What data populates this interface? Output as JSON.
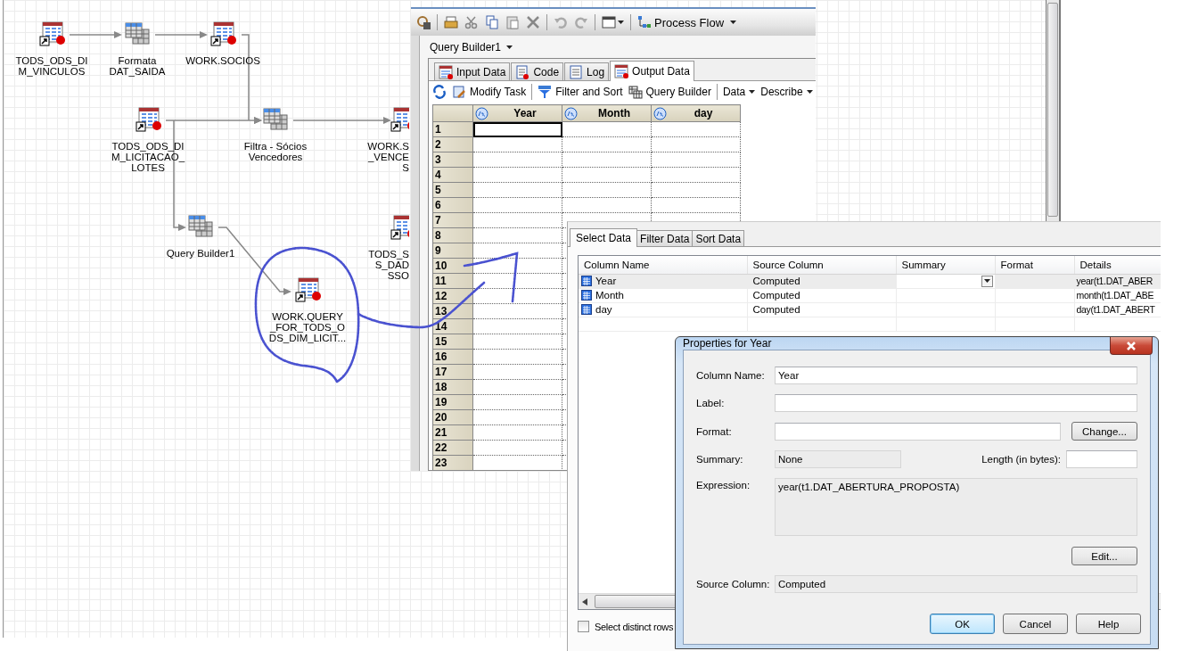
{
  "flow": {
    "nodes": [
      {
        "kind": "dataset",
        "lines": [
          "TODS_ODS_DI",
          "M_VINCULOS"
        ]
      },
      {
        "kind": "task",
        "lines": [
          "Formata",
          "DAT_SAIDA"
        ]
      },
      {
        "kind": "dataset",
        "lines": [
          "WORK.SOCIOS"
        ]
      },
      {
        "kind": "dataset",
        "lines": [
          "TODS_ODS_DI",
          "M_LICITACAO_",
          "LOTES"
        ]
      },
      {
        "kind": "task",
        "lines": [
          "Filtra - Sócios",
          "Vencedores"
        ]
      },
      {
        "kind": "dataset",
        "lines": [
          "WORK.S",
          "_VENCE",
          "S"
        ]
      },
      {
        "kind": "task",
        "lines": [
          "Query Builder1"
        ]
      },
      {
        "kind": "dataset",
        "lines": [
          "TODS_S",
          "S_DAD",
          "SSO"
        ]
      },
      {
        "kind": "dataset",
        "lines": [
          "WORK.QUERY",
          "_FOR_TODS_O",
          "DS_DIM_LICIT..."
        ]
      }
    ]
  },
  "results_window": {
    "toolbar": {
      "process_flow": "Process Flow"
    },
    "title": "Query Builder1",
    "tabs": [
      {
        "label": "Input Data",
        "selected": false
      },
      {
        "label": "Code",
        "selected": false
      },
      {
        "label": "Log",
        "selected": false
      },
      {
        "label": "Output Data",
        "selected": true
      }
    ],
    "actions": [
      {
        "kind": "button",
        "label": "Modify Task"
      },
      {
        "kind": "button",
        "label": "Filter and Sort"
      },
      {
        "kind": "button",
        "label": "Query Builder"
      },
      {
        "kind": "menu",
        "label": "Data"
      },
      {
        "kind": "menu",
        "label": "Describe"
      }
    ],
    "grid": {
      "columns": [
        "Year",
        "Month",
        "day"
      ],
      "rows": [
        {
          "label": "1",
          "selected": true
        },
        {
          "label": "2",
          "selected": false
        },
        {
          "label": "3",
          "selected": false
        },
        {
          "label": "4",
          "selected": false
        },
        {
          "label": "5",
          "selected": false
        },
        {
          "label": "6",
          "selected": false
        },
        {
          "label": "7",
          "selected": false
        },
        {
          "label": "8",
          "selected": false
        },
        {
          "label": "9",
          "selected": false
        },
        {
          "label": "10",
          "selected": false
        },
        {
          "label": "11",
          "selected": false
        },
        {
          "label": "12",
          "selected": false
        },
        {
          "label": "13",
          "selected": false
        },
        {
          "label": "14",
          "selected": false
        },
        {
          "label": "15",
          "selected": false
        },
        {
          "label": "16",
          "selected": false
        },
        {
          "label": "17",
          "selected": false
        },
        {
          "label": "18",
          "selected": false
        },
        {
          "label": "19",
          "selected": false
        },
        {
          "label": "20",
          "selected": false
        },
        {
          "label": "21",
          "selected": false
        },
        {
          "label": "22",
          "selected": false
        },
        {
          "label": "23",
          "selected": false
        }
      ]
    }
  },
  "query_panel": {
    "tabs": [
      {
        "label": "Select Data",
        "selected": true
      },
      {
        "label": "Filter Data",
        "selected": false
      },
      {
        "label": "Sort Data",
        "selected": false
      }
    ],
    "table": {
      "columns": [
        "Column Name",
        "Source Column",
        "Summary",
        "Format",
        "Details"
      ],
      "rows": [
        {
          "column_name": "Year",
          "source_column": "Computed",
          "details": "year(t1.DAT_ABER",
          "selected": true
        },
        {
          "column_name": "Month",
          "source_column": "Computed",
          "details": "month(t1.DAT_ABE",
          "selected": false
        },
        {
          "column_name": "day",
          "source_column": "Computed",
          "details": "day(t1.DAT_ABERT",
          "selected": false
        }
      ]
    },
    "distinct_rows": {
      "label": "Select distinct rows",
      "checked": false
    }
  },
  "dialog": {
    "title": "Properties for Year",
    "column_name": {
      "label": "Column Name:",
      "value": "Year"
    },
    "label": {
      "label": "Label:"
    },
    "format": {
      "label": "Format:",
      "button": "Change..."
    },
    "summary": {
      "label": "Summary:",
      "value": "None"
    },
    "length": {
      "label": "Length (in bytes):"
    },
    "expression": {
      "label": "Expression:",
      "value": "year(t1.DAT_ABERTURA_PROPOSTA)",
      "button": "Edit..."
    },
    "source_column": {
      "label": "Source Column:",
      "value": "Computed"
    },
    "buttons": [
      {
        "label": "OK",
        "default": true
      },
      {
        "label": "Cancel",
        "default": false
      },
      {
        "label": "Help",
        "default": false
      }
    ]
  }
}
